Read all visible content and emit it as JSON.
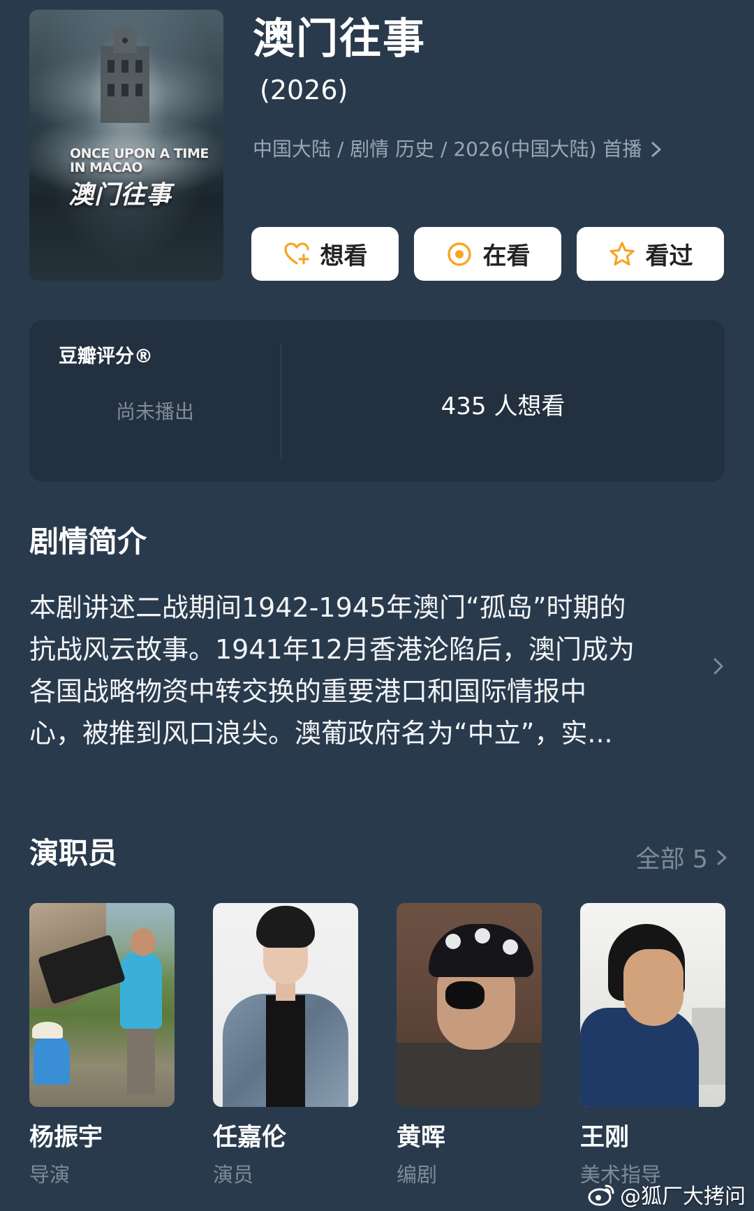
{
  "poster": {
    "en_title": "ONCE UPON A TIME IN MACAO",
    "cn_title": "澳门往事"
  },
  "header": {
    "title": "澳门往事",
    "year": "(2026)",
    "meta": "中国大陆 / 剧情 历史 / 2026(中国大陆) 首播"
  },
  "actions": [
    {
      "label": "想看",
      "icon": "heart-plus-icon"
    },
    {
      "label": "在看",
      "icon": "target-icon"
    },
    {
      "label": "看过",
      "icon": "star-icon"
    }
  ],
  "rating": {
    "brand": "豆瓣评分®",
    "status": "尚未播出",
    "want_count": "435 人想看"
  },
  "synopsis": {
    "title": "剧情简介",
    "lines": [
      "本剧讲述二战期间1942-1945年澳门“孤岛”时期的",
      "抗战风云故事。1941年12月香港沦陷后，澳门成为",
      "各国战略物资中转交换的重要港口和国际情报中",
      "心，被推到风口浪尖。澳葡政府名为“中立”，实..."
    ]
  },
  "cast": {
    "title": "演职员",
    "all_label": "全部 5",
    "members": [
      {
        "name": "杨振宇",
        "role": "导演"
      },
      {
        "name": "任嘉伦",
        "role": "演员"
      },
      {
        "name": "黄晖",
        "role": "编剧"
      },
      {
        "name": "王刚",
        "role": "美术指导"
      }
    ]
  },
  "watermark": {
    "text": "@狐厂大拷问"
  },
  "colors": {
    "background": "#2a3a4d",
    "card": "#22303f",
    "muted_text": "#7f8b97",
    "accent": "#f5a623"
  }
}
